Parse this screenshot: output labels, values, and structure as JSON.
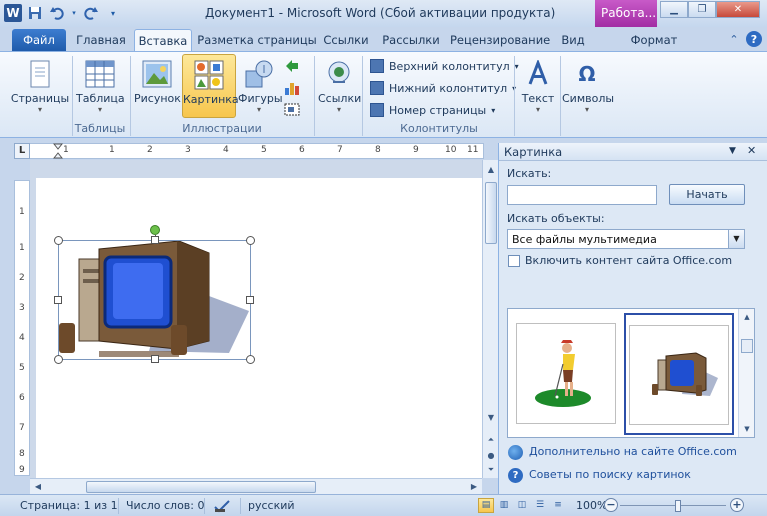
{
  "window": {
    "title": "Документ1 - Microsoft Word (Сбой активации продукта)",
    "contextual_group": "Работа...",
    "qat_icons": [
      "word-logo-icon",
      "save-icon",
      "undo-icon",
      "redo-icon",
      "customize-qat-icon"
    ]
  },
  "tabs": [
    {
      "label": "Файл"
    },
    {
      "label": "Главная"
    },
    {
      "label": "Вставка"
    },
    {
      "label": "Разметка страницы"
    },
    {
      "label": "Ссылки"
    },
    {
      "label": "Рассылки"
    },
    {
      "label": "Рецензирование"
    },
    {
      "label": "Вид"
    },
    {
      "label": "Формат"
    }
  ],
  "active_tab": "Вставка",
  "ribbon": {
    "pages": "Страницы",
    "table": "Таблица",
    "picture": "Рисунок",
    "clipart": "Картинка",
    "shapes": "Фигуры",
    "links": "Ссылки",
    "header": "Верхний колонтитул",
    "footer": "Нижний колонтитул",
    "page_number": "Номер страницы",
    "text": "Текст",
    "symbols": "Символы",
    "groups": {
      "tables": "Таблицы",
      "illustrations": "Иллюстрации",
      "headers_footers": "Колонтитулы"
    }
  },
  "ruler": {
    "h_numbers": [
      "1",
      "1",
      "2",
      "3",
      "4",
      "5",
      "6",
      "7",
      "8",
      "9",
      "10",
      "11"
    ],
    "v_numbers": [
      "1",
      "1",
      "2",
      "3",
      "4",
      "5",
      "6",
      "7",
      "8",
      "9"
    ]
  },
  "pane": {
    "title": "Картинка",
    "search_label": "Искать:",
    "search_value": "",
    "go_button": "Начать",
    "results_label": "Искать объекты:",
    "media_type": "Все файлы мультимедиа",
    "include_office": "Включить контент сайта Office.com",
    "include_office_checked": false,
    "more_link": "Дополнительно на сайте Office.com",
    "tips_link": "Советы по поиску картинок"
  },
  "status": {
    "page": "Страница: 1 из 1",
    "words": "Число слов: 0",
    "language": "русский",
    "zoom": "100%",
    "zoom_percent": 100
  }
}
